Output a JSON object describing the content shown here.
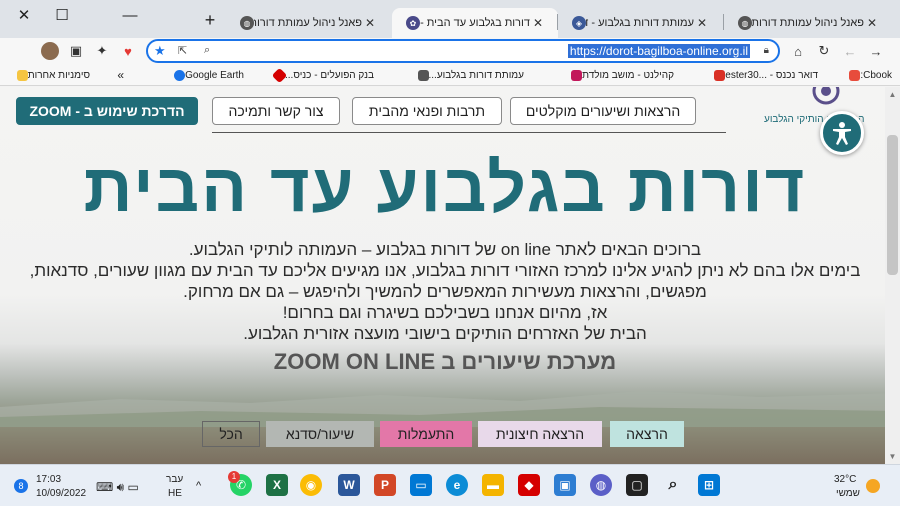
{
  "window": {
    "close": "✕",
    "maximize": "☐",
    "minimize": "—",
    "new_tab": "+"
  },
  "tabs": [
    {
      "title": "פאנל ניהול עמותת דורות בגלבוע",
      "active": false
    },
    {
      "title": "עמותת דורות בגלבוע - דף",
      "active": false
    },
    {
      "title": "דורות בגלבוע עד הבית - דו",
      "active": true
    },
    {
      "title": "פאנל ניהול עמותת דורות בגלבוע",
      "active": false
    }
  ],
  "toolbar": {
    "url": "https://dorot-bagilboa-online.org.il",
    "icons": [
      "back-icon",
      "forward-icon",
      "reload-icon",
      "home-icon",
      "lock-icon",
      "share-icon",
      "zoom-icon",
      "star-icon"
    ]
  },
  "bookmarks": [
    {
      "label": "Cbook:",
      "color": "#e74c3c"
    },
    {
      "label": "דואר נכנס - ...ester30",
      "color": "#d93025"
    },
    {
      "label": "קהילנט - מושב מולדת",
      "color": "#c2185b"
    },
    {
      "label": "עמותת דורות בגלבוע...",
      "color": "#555555"
    },
    {
      "label": "בנק הפועלים - כניס...",
      "color": "#d50000"
    },
    {
      "label": "Google Earth",
      "color": "#1a73e8"
    }
  ],
  "bookmarks_more": "»",
  "bookmarks_other": "סימניות אחרות",
  "page": {
    "nav": {
      "lectures": "הרצאות ושיעורים מוקלטים",
      "culture": "תרבות ופנאי מהבית",
      "contact": "צור קשר ותמיכה",
      "zoom_guide": "הדרכת שימוש ב - ZOOM"
    },
    "logo_text": "הגמלאים הותיקי הגלבוע",
    "title": "דורות בגלבוע עד הבית",
    "intro_lines": [
      "ברוכים הבאים לאתר on line של דורות בגלבוע – העמותה לותיקי הגלבוע.",
      "בימים אלו בהם לא ניתן להגיע אלינו למרכז האזורי דורות בגלבוע, אנו מגיעים אליכם עד הבית עם מגוון שעורים, סדנאות,",
      "מפגשים, והרצאות מעשירות המאפשרים להמשיך ולהיפגש – גם אם מרחוק.",
      "אז, מהיום אנחנו בשבילכם בשיגרה וגם בחרום!",
      "הבית של האזרחים הותיקים בישובי מועצה אזורית הגלבוע."
    ],
    "subhead": "מערכת שיעורים ב ZOOM ON LINE",
    "filters": [
      {
        "label": "הרצאה",
        "bg": "#bfe3df"
      },
      {
        "label": "הרצאה חיצונית",
        "bg": "#e8d9ea"
      },
      {
        "label": "התעמלות",
        "bg": "#e377a8"
      },
      {
        "label": "שיעור/סדנא",
        "bg": "#b3b7b3"
      },
      {
        "label": "הכל",
        "bg": "transparent"
      }
    ]
  },
  "taskbar": {
    "weather_temp": "32°C",
    "weather_desc": "שמשי",
    "lang_top": "עבר",
    "lang_bottom": "HE",
    "time": "17:03",
    "date": "10/09/2022",
    "notif_count": "8",
    "whatsapp_badge": "1"
  }
}
